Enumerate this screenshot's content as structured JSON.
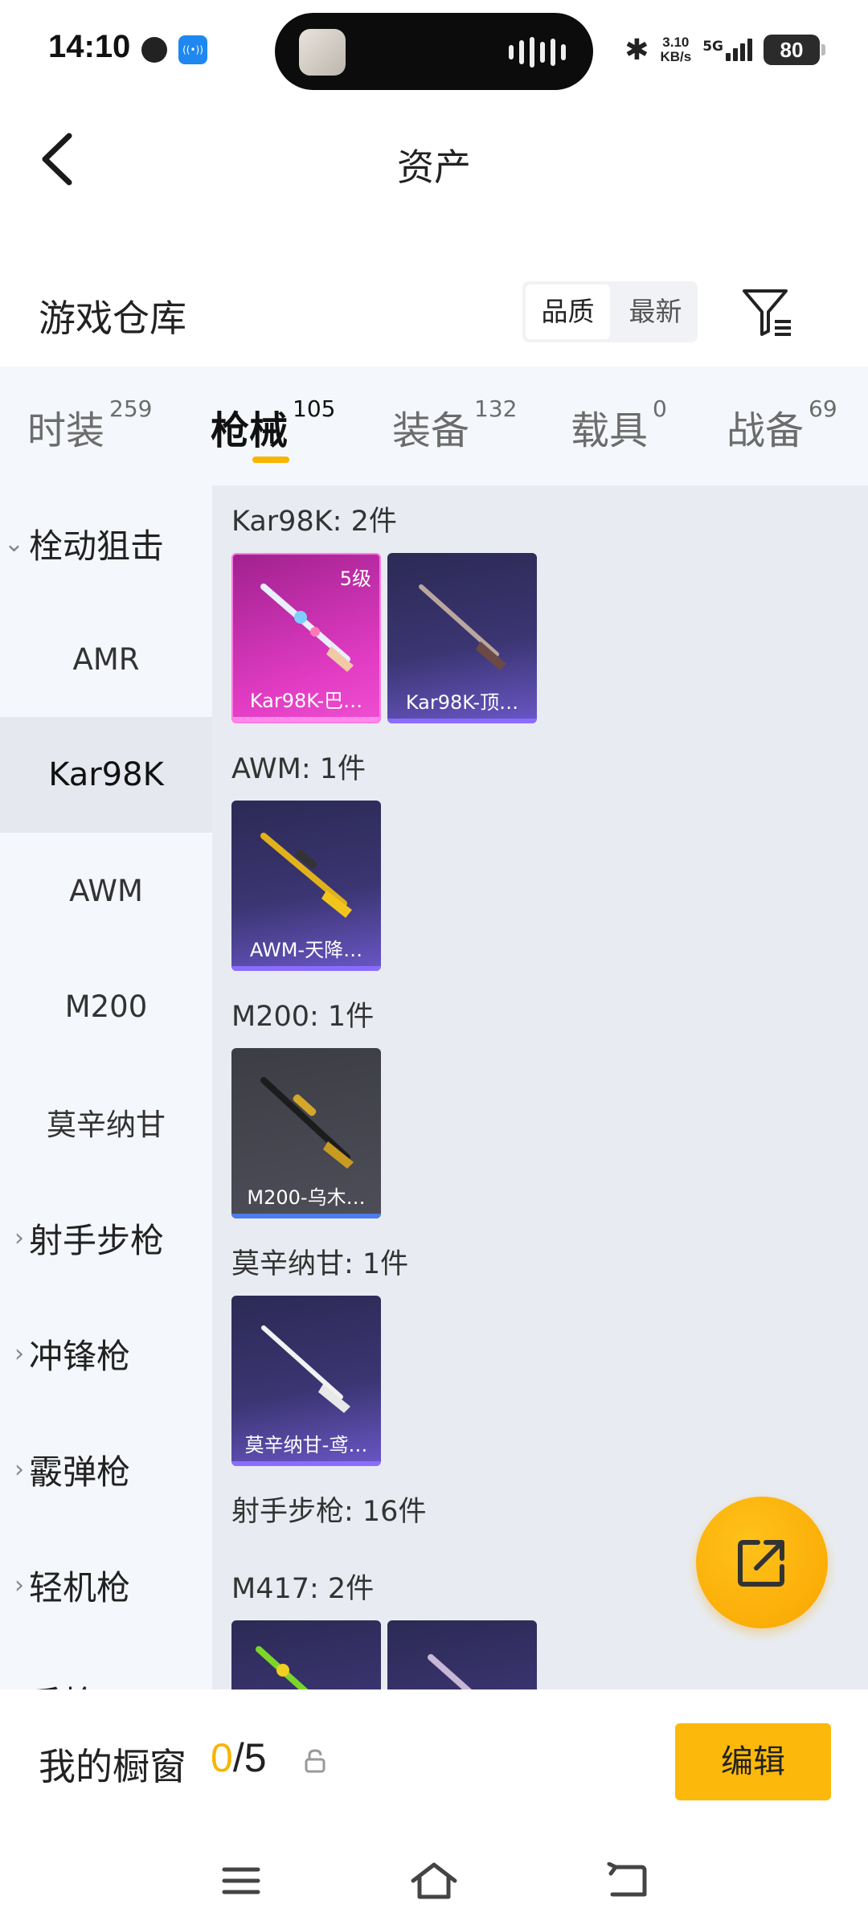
{
  "status_bar": {
    "time": "14:10",
    "network_speed_value": "3.10",
    "network_speed_unit": "KB/s",
    "network_type": "5G",
    "battery": "80",
    "icons": [
      "globe-icon",
      "hotspot-icon",
      "bluetooth-icon",
      "signal-icon",
      "battery-icon"
    ]
  },
  "header": {
    "title": "资产",
    "back_icon": "chevron-left-icon"
  },
  "warehouse": {
    "title": "游戏仓库",
    "sort_options": [
      {
        "label": "品质",
        "active": true
      },
      {
        "label": "最新",
        "active": false
      }
    ],
    "filter_icon": "filter-icon"
  },
  "tabs": [
    {
      "label": "时装",
      "count": "259",
      "active": false
    },
    {
      "label": "枪械",
      "count": "105",
      "active": true
    },
    {
      "label": "装备",
      "count": "132",
      "active": false
    },
    {
      "label": "载具",
      "count": "0",
      "active": false
    },
    {
      "label": "战备",
      "count": "69",
      "active": false
    }
  ],
  "sidebar": {
    "items": [
      {
        "label": "栓动狙击",
        "type": "group",
        "expanded": true
      },
      {
        "label": "AMR",
        "type": "sub",
        "active": false
      },
      {
        "label": "Kar98K",
        "type": "sub",
        "active": true
      },
      {
        "label": "AWM",
        "type": "sub",
        "active": false
      },
      {
        "label": "M200",
        "type": "sub",
        "active": false
      },
      {
        "label": "莫辛纳甘",
        "type": "sub",
        "active": false
      },
      {
        "label": "射手步枪",
        "type": "group",
        "expanded": false
      },
      {
        "label": "冲锋枪",
        "type": "group",
        "expanded": false
      },
      {
        "label": "霰弹枪",
        "type": "group",
        "expanded": false
      },
      {
        "label": "轻机枪",
        "type": "group",
        "expanded": false
      },
      {
        "label": "手枪",
        "type": "group",
        "expanded": false
      }
    ]
  },
  "content": {
    "sections": [
      {
        "title": "Kar98K: 2件",
        "items": [
          {
            "name": "Kar98K-巴…",
            "level": "5级",
            "rarity": "legendary",
            "color": "#e23cc4"
          },
          {
            "name": "Kar98K-顶…",
            "rarity": "epic",
            "color": "#6a57c7"
          }
        ]
      },
      {
        "title": "AWM: 1件",
        "items": [
          {
            "name": "AWM-天降…",
            "rarity": "epic",
            "color": "#6a57c7"
          }
        ]
      },
      {
        "title": "M200: 1件",
        "items": [
          {
            "name": "M200-乌木…",
            "rarity": "rare",
            "color": "#4d7bf0"
          }
        ]
      },
      {
        "title": "莫辛纳甘: 1件",
        "items": [
          {
            "name": "莫辛纳甘-鸢…",
            "rarity": "epic",
            "color": "#6a57c7"
          }
        ]
      },
      {
        "title": "射手步枪: 16件",
        "items": []
      },
      {
        "title": "M417: 2件",
        "items": [
          {
            "name": "",
            "rarity": "epic",
            "color": "#6a57c7"
          },
          {
            "name": "",
            "rarity": "epic",
            "color": "#6a57c7"
          }
        ]
      }
    ]
  },
  "fab": {
    "icon": "share-icon"
  },
  "showcase": {
    "title": "我的橱窗",
    "current": "0",
    "total": "/5",
    "lock_icon": "lock-icon",
    "edit_label": "编辑"
  },
  "nav": {
    "icons": [
      "menu-icon",
      "home-icon",
      "back-icon"
    ]
  },
  "colors": {
    "accent": "#f7b500",
    "edit_button": "#fdb90b",
    "legendary": "#e23cc4",
    "epic": "#6a57c7",
    "rare": "#4d7bf0"
  }
}
